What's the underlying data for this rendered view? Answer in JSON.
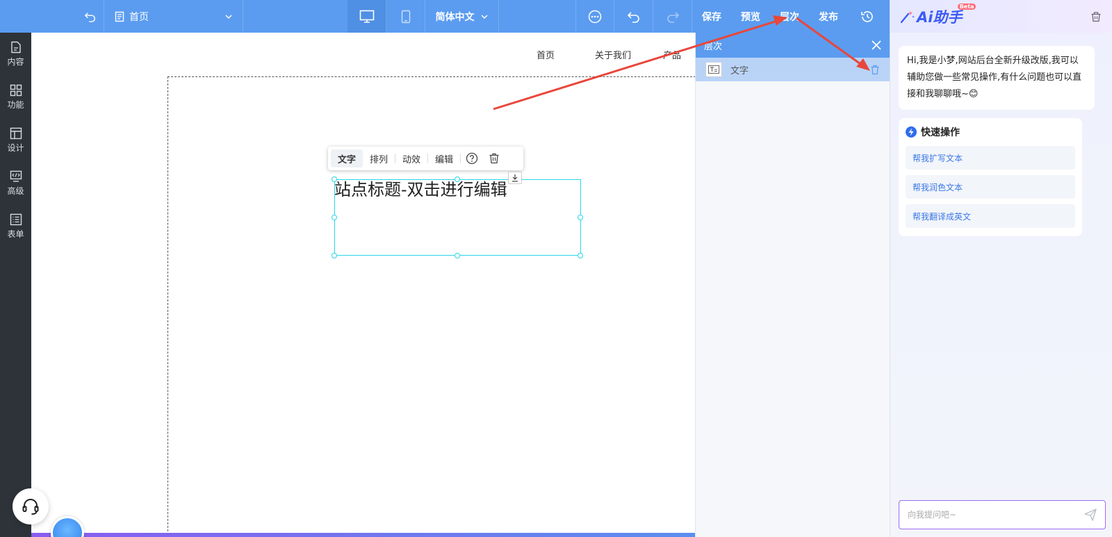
{
  "topbar": {
    "page_label": "首页",
    "language": "简体中文",
    "save": "保存",
    "preview": "预览",
    "layers": "层次",
    "publish": "发布"
  },
  "sidebar": {
    "items": [
      {
        "label": "内容",
        "icon": "file-icon"
      },
      {
        "label": "功能",
        "icon": "grid-icon"
      },
      {
        "label": "设计",
        "icon": "layout-icon"
      },
      {
        "label": "高级",
        "icon": "code-icon"
      },
      {
        "label": "表单",
        "icon": "form-icon"
      }
    ]
  },
  "canvas": {
    "nav": [
      "首页",
      "关于我们",
      "产品"
    ],
    "toolbar": {
      "tabs": [
        "文字",
        "排列",
        "动效",
        "编辑"
      ]
    },
    "element_text": "站点标题-双击进行编辑"
  },
  "layers_panel": {
    "title": "层次",
    "row_label": "文字"
  },
  "ai": {
    "badge": "Beta",
    "logo_text": "Ai助手",
    "greeting": "Hi,我是小梦,网站后台全新升级改版,我可以辅助您做一些常见操作,有什么问题也可以直接和我聊聊哦~😊",
    "quick_title": "快速操作",
    "quick_items": [
      "帮我扩写文本",
      "帮我润色文本",
      "帮我翻译成英文"
    ],
    "input_placeholder": "向我提问吧~"
  },
  "colors": {
    "topbar": "#5b9cf0",
    "sidebar": "#2d3339",
    "accent": "#3b78e7",
    "selection": "#2ad6e8",
    "arrow": "#e8473b"
  }
}
